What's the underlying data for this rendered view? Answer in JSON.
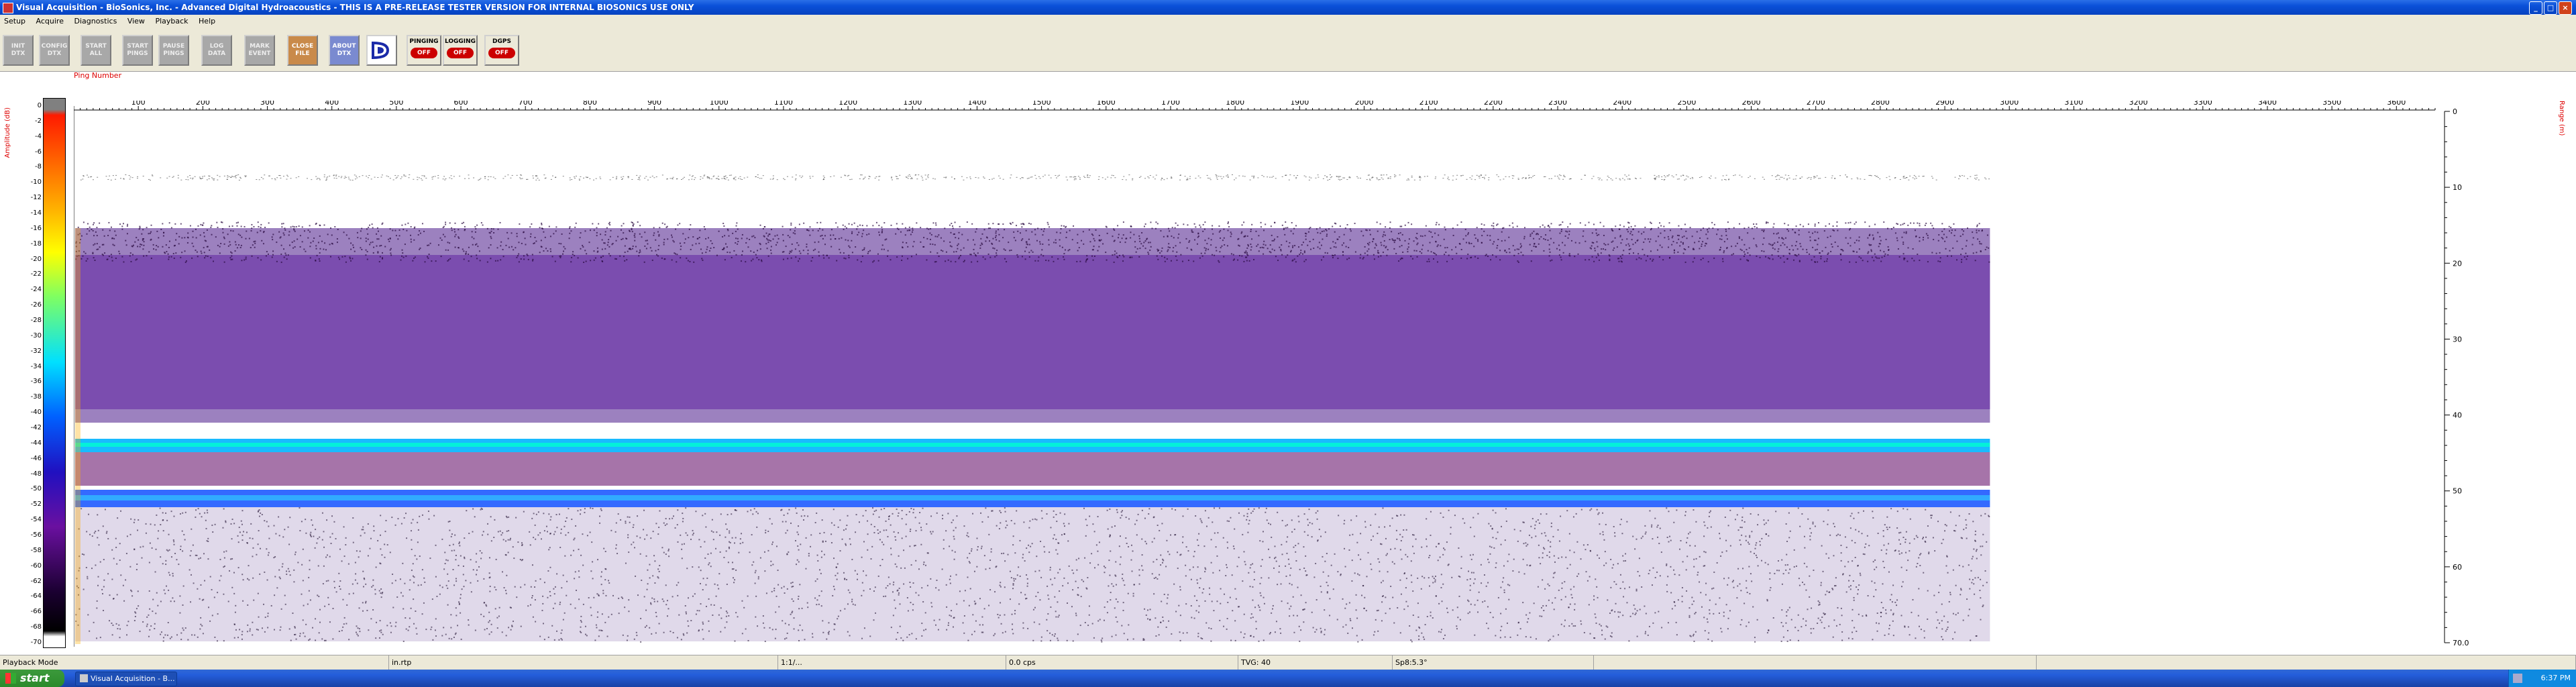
{
  "window": {
    "title": "Visual Acquisition  -  BioSonics, Inc.   -   Advanced Digital Hydroacoustics   -   THIS IS A PRE-RELEASE TESTER VERSION FOR INTERNAL BIOSONICS USE ONLY",
    "minimize": "_",
    "maximize": "□",
    "close": "×"
  },
  "menubar": [
    "Setup",
    "Acquire",
    "Diagnostics",
    "View",
    "Playback",
    "Help"
  ],
  "toolbar": {
    "buttons": [
      {
        "id": "init",
        "label": "INIT\nDTX"
      },
      {
        "id": "config",
        "label": "CONFIG\nDTX"
      },
      {
        "id": "start-all",
        "label": "START\nALL"
      },
      {
        "id": "start-pings",
        "label": "START\nPINGS"
      },
      {
        "id": "pause-pings",
        "label": "PAUSE\nPINGS"
      },
      {
        "id": "log-data",
        "label": "LOG\nDATA"
      },
      {
        "id": "mark-event",
        "label": "MARK\nEVENT"
      },
      {
        "id": "close-file",
        "label": "CLOSE\nFILE"
      },
      {
        "id": "about-dtx",
        "label": "ABOUT\nDTX"
      }
    ],
    "states": [
      {
        "label": "PINGING",
        "value": "OFF"
      },
      {
        "label": "LOGGING",
        "value": "OFF"
      },
      {
        "label": "DGPS",
        "value": "OFF"
      }
    ]
  },
  "echogram": {
    "x_axis_title": "Ping Number",
    "x_ticks": [
      100,
      200,
      300,
      400,
      500,
      600,
      700,
      800,
      900,
      1000,
      1100,
      1200,
      1300,
      1400,
      1500,
      1600,
      1700,
      1800,
      1900,
      2000,
      2100,
      2200,
      2300,
      2400,
      2500,
      2600,
      2700,
      2800,
      2900,
      3000,
      3100,
      3200,
      3300,
      3400,
      3500,
      3600
    ],
    "x_range": [
      0,
      3660
    ],
    "data_end_ping": 2970,
    "colorbar_title": "Amplitude (dB)",
    "colorbar_ticks": [
      "0",
      "-2",
      "-4",
      "-6",
      "-8",
      "-10",
      "-12",
      "-14",
      "-16",
      "-18",
      "-20",
      "-22",
      "-24",
      "-26",
      "-28",
      "-30",
      "-32",
      "-34",
      "-36",
      "-38",
      "-40",
      "-42",
      "-44",
      "-46",
      "-48",
      "-50",
      "-52",
      "-54",
      "-56",
      "-58",
      "-60",
      "-62",
      "-64",
      "-66",
      "-68",
      "-70"
    ],
    "right_axis_title": "Range (m)",
    "right_ticks": [
      "0",
      "10",
      "20",
      "30",
      "40",
      "50",
      "60",
      "70.0"
    ],
    "range_max": 70
  },
  "statusbar": [
    "Playback Mode",
    "in.rtp",
    "1:1/...",
    "0.0 cps",
    "TVG: 40",
    "Sp8:5.3°",
    "",
    ""
  ],
  "taskbar": {
    "start_label": "start",
    "task_item": "Visual Acquisition - B...",
    "clock": "6:37 PM"
  }
}
